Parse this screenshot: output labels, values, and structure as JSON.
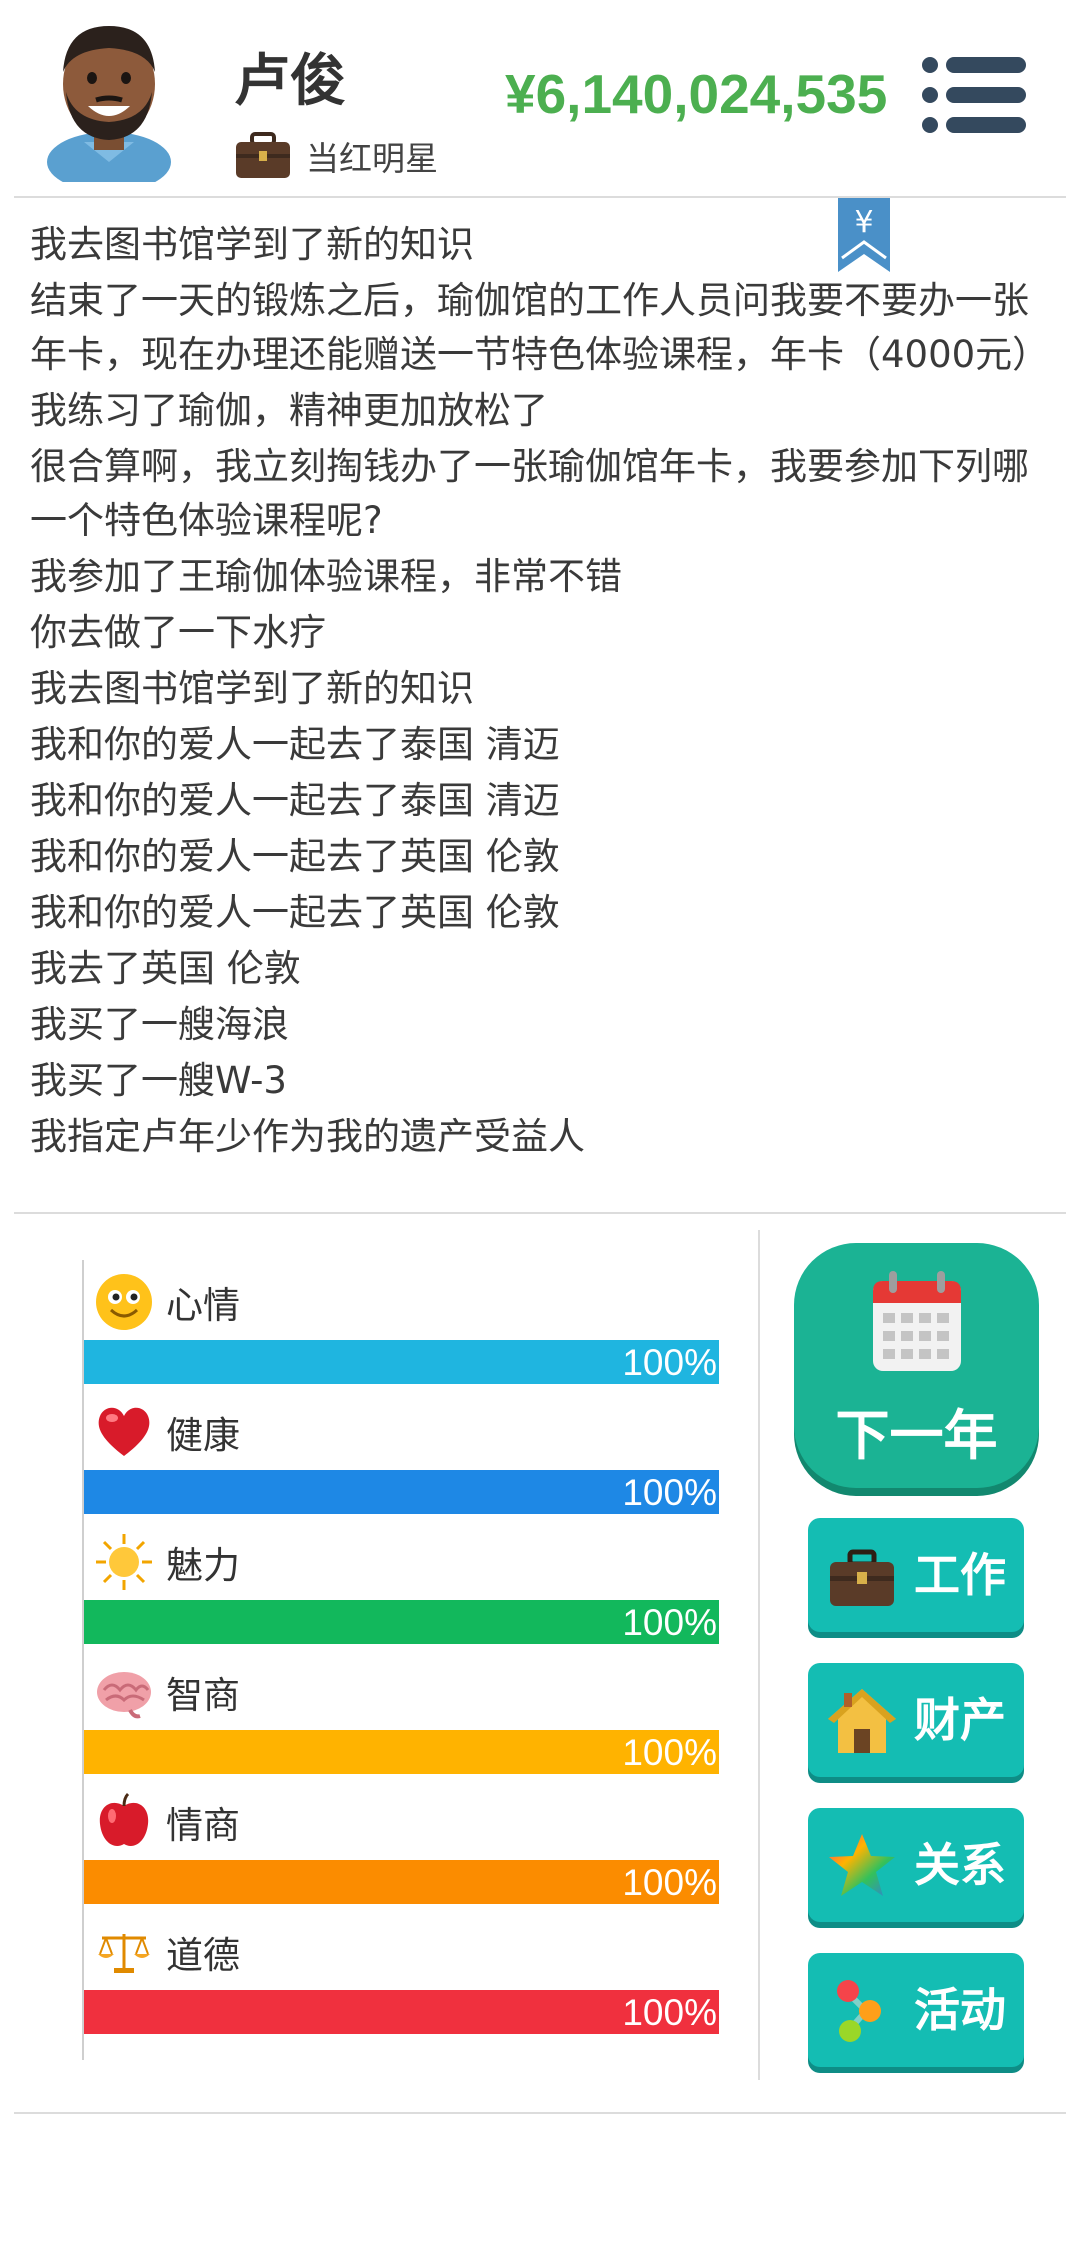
{
  "header": {
    "name": "卢俊",
    "job": "当红明星",
    "money": "¥6,140,024,535"
  },
  "log": {
    "lines": [
      "我去图书馆学到了新的知识",
      "结束了一天的锻炼之后，瑜伽馆的工作人员问我要不要办一张年卡，现在办理还能赠送一节特色体验课程，年卡（4000元）",
      "我练习了瑜伽，精神更加放松了",
      "很合算啊，我立刻掏钱办了一张瑜伽馆年卡，我要参加下列哪一个特色体验课程呢?",
      "我参加了王瑜伽体验课程，非常不错",
      "你去做了一下水疗",
      "我去图书馆学到了新的知识",
      "我和你的爱人一起去了泰国 清迈",
      "我和你的爱人一起去了泰国 清迈",
      "我和你的爱人一起去了英国 伦敦",
      "我和你的爱人一起去了英国 伦敦",
      "我去了英国 伦敦",
      "我买了一艘海浪",
      "我买了一艘W-3",
      "我指定卢年少作为我的遗产受益人"
    ],
    "bookmark_symbol": "¥"
  },
  "stats": [
    {
      "name": "心情",
      "value": 100,
      "text": "100%",
      "color": "#1fb5e0",
      "icon": "smiley-icon"
    },
    {
      "name": "健康",
      "value": 100,
      "text": "100%",
      "color": "#1e88e5",
      "icon": "heart-icon"
    },
    {
      "name": "魅力",
      "value": 100,
      "text": "100%",
      "color": "#12b85c",
      "icon": "sun-icon"
    },
    {
      "name": "智商",
      "value": 100,
      "text": "100%",
      "color": "#ffb300",
      "icon": "brain-icon"
    },
    {
      "name": "情商",
      "value": 100,
      "text": "100%",
      "color": "#fb8c00",
      "icon": "apple-icon"
    },
    {
      "name": "道德",
      "value": 100,
      "text": "100%",
      "color": "#f0303e",
      "icon": "scales-icon"
    }
  ],
  "buttons": {
    "next_year": "下一年",
    "work": "工作",
    "property": "财产",
    "relations": "关系",
    "activities": "活动"
  }
}
